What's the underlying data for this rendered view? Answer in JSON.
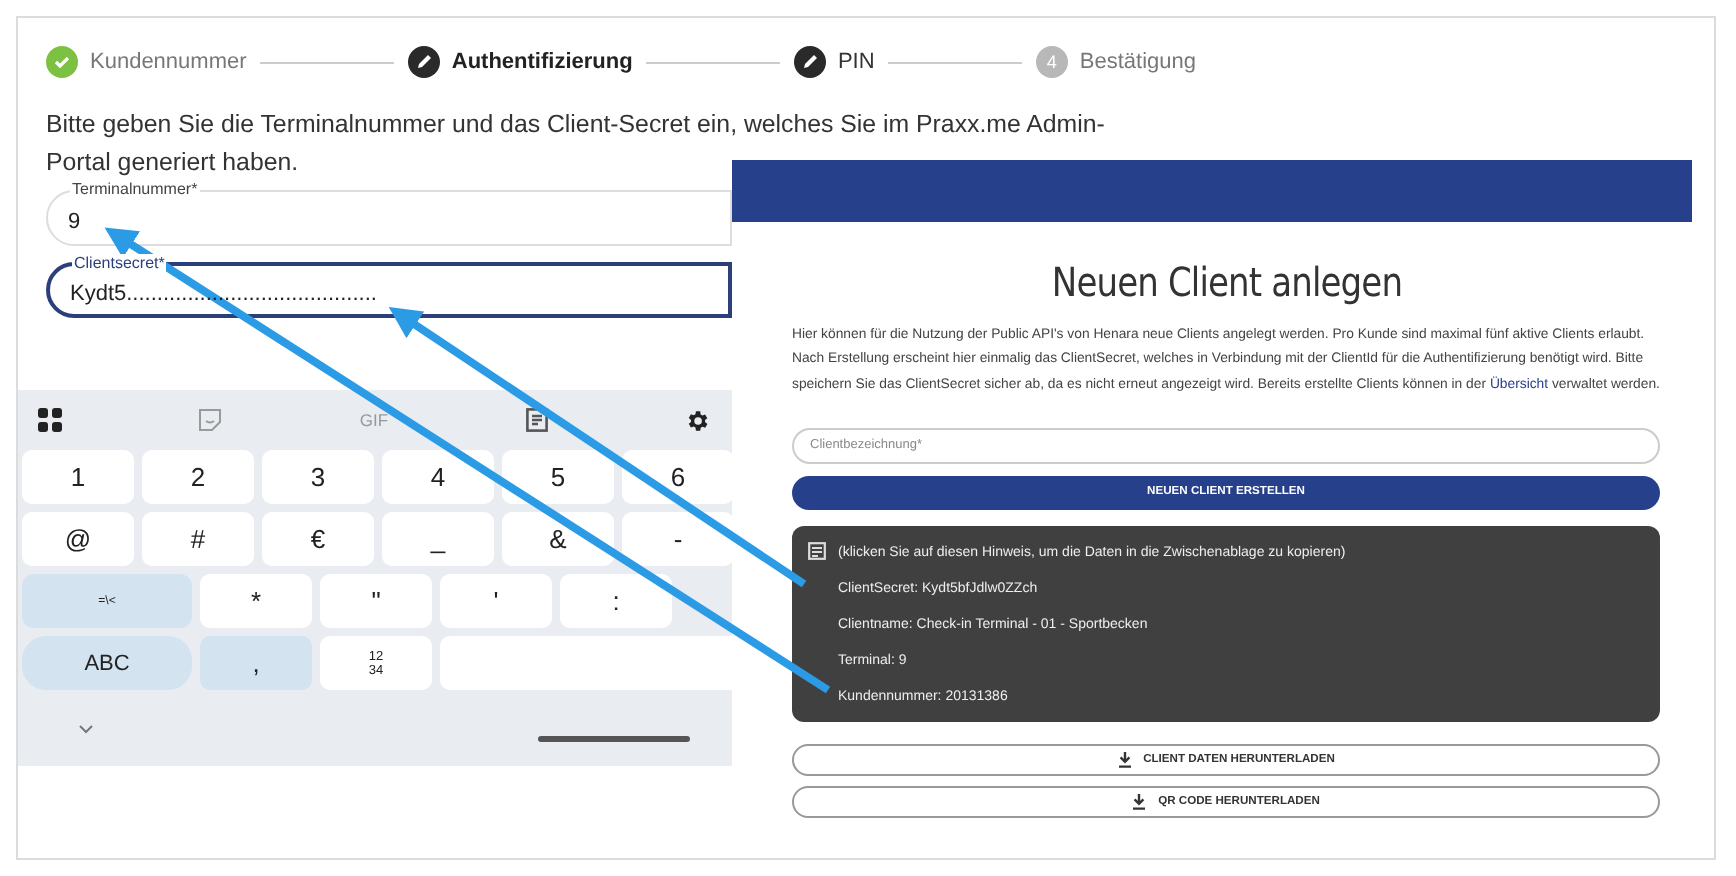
{
  "stepper": {
    "steps": [
      {
        "label": "Kundennummer",
        "kind": "done"
      },
      {
        "label": "Authentifizierung",
        "kind": "active"
      },
      {
        "label": "PIN",
        "kind": "edit"
      },
      {
        "label": "Bestätigung",
        "kind": "pending",
        "number": "4"
      }
    ]
  },
  "instructions": "Bitte geben Sie die Terminalnummer und das Client-Secret ein, welches Sie im Praxx.me Admin-Portal generiert haben.",
  "fields": [
    {
      "label": "Terminalnummer*",
      "value": "9",
      "focused": false
    },
    {
      "label": "Clientsecret*",
      "value": "Kydt5.........................................",
      "focused": true
    }
  ],
  "keyboard": {
    "toolbar": {
      "gif_label": "GIF"
    },
    "rows": [
      [
        {
          "label": "1",
          "kind": "char"
        },
        {
          "label": "2",
          "kind": "char"
        },
        {
          "label": "3",
          "kind": "char"
        },
        {
          "label": "4",
          "kind": "char"
        },
        {
          "label": "5",
          "kind": "char"
        },
        {
          "label": "6",
          "kind": "char"
        }
      ],
      [
        {
          "label": "@",
          "kind": "char"
        },
        {
          "label": "#",
          "kind": "char"
        },
        {
          "label": "€",
          "kind": "char"
        },
        {
          "label": "_",
          "kind": "char"
        },
        {
          "label": "&",
          "kind": "char"
        },
        {
          "label": "-",
          "kind": "char"
        }
      ],
      [
        {
          "label": "=\\<",
          "kind": "mode"
        },
        {
          "label": "*",
          "kind": "char"
        },
        {
          "label": "\"",
          "kind": "char"
        },
        {
          "label": "'",
          "kind": "char"
        },
        {
          "label": ":",
          "kind": "char"
        }
      ],
      [
        {
          "label": "ABC",
          "kind": "mode"
        },
        {
          "label": ",",
          "kind": "function"
        },
        {
          "label": "12\n34",
          "kind": "char"
        },
        {
          "kind": "space"
        }
      ]
    ]
  },
  "client_panel": {
    "title": "Neuen Client anlegen",
    "description": {
      "text_before": "Hier können für die Nutzung der Public API's von Henara neue Clients angelegt werden. Pro Kunde sind maximal fünf aktive Clients erlaubt. Nach Erstellung erscheint hier einmalig das ClientSecret, welches in Verbindung mit der ClientId für die Authentifizierung benötigt wird. Bitte speichern Sie das ClientSecret sicher ab, da es nicht erneut angezeigt wird. Bereits erstellte Clients können in der ",
      "link": "Übersicht",
      "text_after": " verwaltet werden."
    },
    "name_field": {
      "placeholder": "Clientbezeichnung*"
    },
    "create_button": "NEUEN CLIENT ERSTELLEN",
    "result": {
      "hint": "(klicken Sie auf diesen Hinweis, um die Daten in die Zwischenablage zu kopieren)",
      "lines": [
        "ClientSecret: Kydt5bfJdlw0ZZch",
        "Clientname: Check-in Terminal - 01 - Sportbecken",
        "Terminal: 9",
        "Kundennummer: 20131386"
      ]
    },
    "download_buttons": [
      "CLIENT DATEN HERUNTERLADEN",
      "QR CODE HERUNTERLADEN"
    ]
  }
}
